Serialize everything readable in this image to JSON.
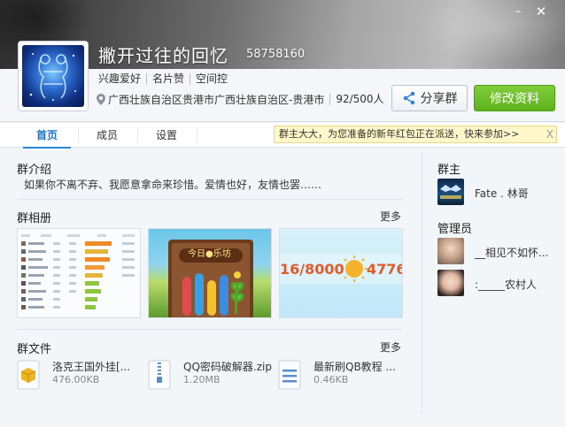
{
  "window": {
    "min_glyph": "–",
    "close_glyph": "✕"
  },
  "header": {
    "group_name": "撇开过往的回忆",
    "group_id": "58758160",
    "tags": [
      "兴趣爱好",
      "名片赞",
      "空间控"
    ],
    "location": "广西壮族自治区贵港市广西壮族自治区-贵港市",
    "member_count": "92/500人",
    "share_label": "分享群",
    "edit_label": "修改资料"
  },
  "tabs": [
    {
      "label": "首页",
      "active": true
    },
    {
      "label": "成员",
      "active": false
    },
    {
      "label": "设置",
      "active": false
    }
  ],
  "notice": {
    "text": "群主大大，为您准备的新年红包正在派送，快来参加>>",
    "close": "X"
  },
  "intro": {
    "title": "群介绍",
    "text": "如果你不离不弃、我愿意拿命来珍惜。爱情也好，友情也罢……"
  },
  "album": {
    "title": "群相册",
    "more": "更多",
    "thumb2_caption": "今日●乐坊",
    "thumb3_number": "16/8000",
    "thumb3_number2": "4776/"
  },
  "files": {
    "title": "群文件",
    "more": "更多",
    "items": [
      {
        "name": "洛克王国外挂[...",
        "size": "476.00KB",
        "icon": "package-icon",
        "color": "#f0b523"
      },
      {
        "name": "QQ密码破解器.zip",
        "size": "1.20MB",
        "icon": "zip-icon",
        "color": "#5a8fc6"
      },
      {
        "name": "最新刷QB教程 ...",
        "size": "0.46KB",
        "icon": "text-doc-icon",
        "color": "#5a8fc6"
      }
    ]
  },
  "sidebar": {
    "owner_title": "群主",
    "owner": {
      "name": "Fate .     林哥"
    },
    "admin_title": "管理员",
    "admins": [
      {
        "name": "__相见不如怀..."
      },
      {
        "name": ":_____农村人"
      }
    ]
  },
  "colors": {
    "accent": "#2b87d8",
    "edit_button": "#62b422",
    "notice_bg": "#fff7c9"
  }
}
